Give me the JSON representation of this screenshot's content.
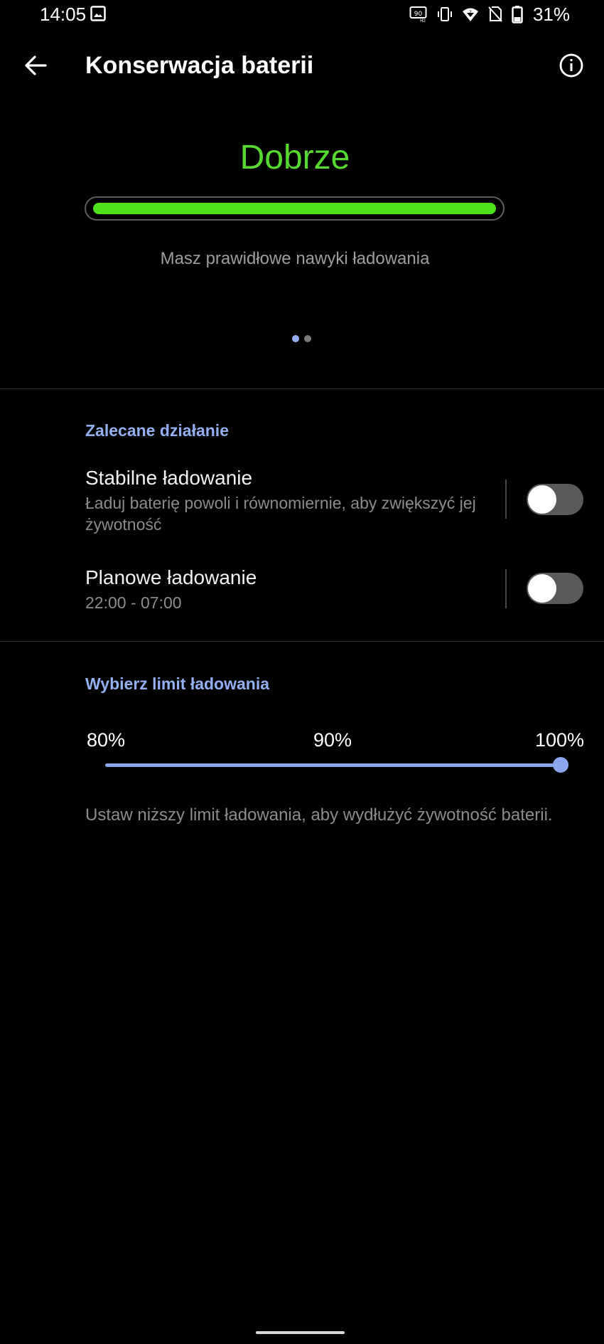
{
  "status_bar": {
    "time": "14:05",
    "battery_percent": "31%",
    "icons": [
      "image-icon",
      "refresh-rate-90hz-icon",
      "vibrate-icon",
      "wifi-icon",
      "no-sim-icon",
      "battery-icon"
    ]
  },
  "app_bar": {
    "title": "Konserwacja baterii",
    "back_icon": "arrow-left-icon",
    "info_icon": "info-icon"
  },
  "status": {
    "label": "Dobrze",
    "label_color": "#56d92f",
    "health_fraction": 1.0,
    "bar_color": "#4de21a",
    "description": "Masz prawidłowe nawyki ładowania",
    "pager": {
      "pages": 2,
      "current": 1
    }
  },
  "recommended": {
    "header": "Zalecane działanie",
    "items": [
      {
        "title": "Stabilne ładowanie",
        "subtitle": "Ładuj baterię powoli i równomiernie, aby zwiększyć jej żywotność",
        "enabled": false
      },
      {
        "title": "Planowe ładowanie",
        "subtitle": "22:00 - 07:00",
        "enabled": false
      }
    ]
  },
  "charge_limit": {
    "header": "Wybierz limit ładowania",
    "options": [
      "80%",
      "90%",
      "100%"
    ],
    "selected": "100%",
    "hint": "Ustaw niższy limit ładowania, aby wydłużyć żywotność baterii."
  },
  "colors": {
    "accent": "#94b0f3",
    "slider": "#8aa7ee",
    "good": "#56d92f"
  }
}
